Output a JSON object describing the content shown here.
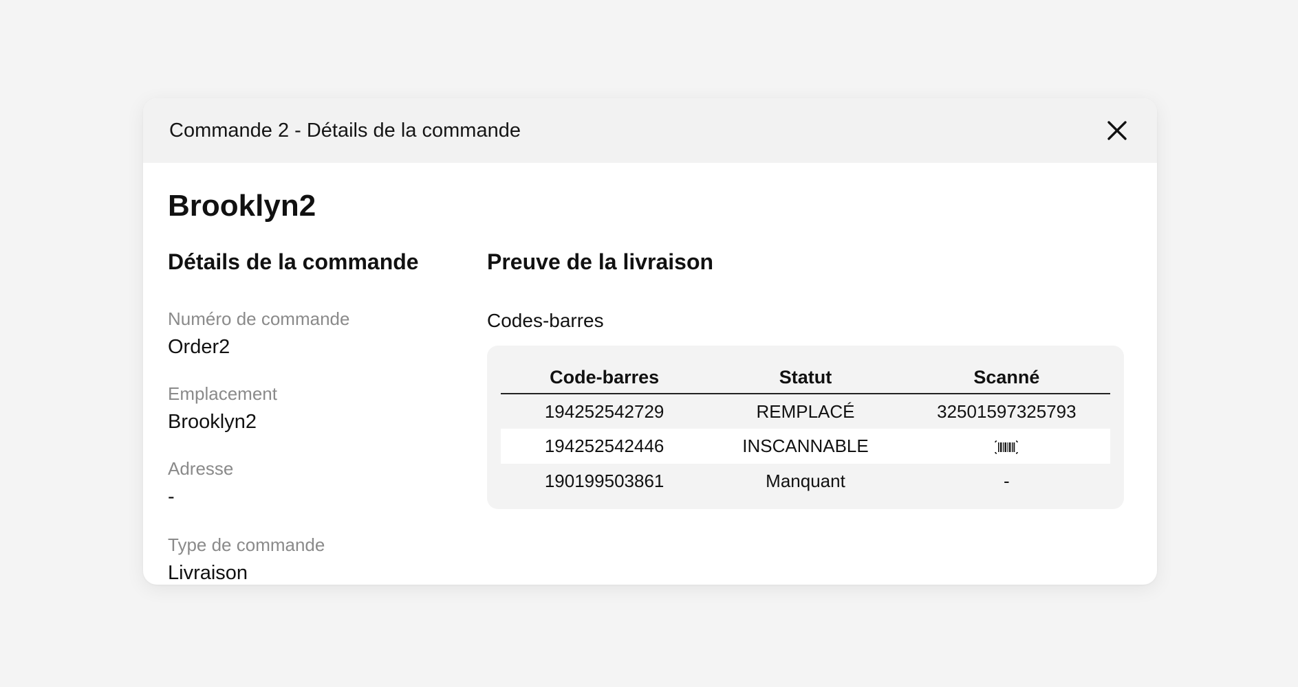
{
  "modal": {
    "title": "Commande 2 - Détails de la commande",
    "close_icon": "close-icon"
  },
  "location_name": "Brooklyn2",
  "order_details": {
    "heading": "Détails de la commande",
    "fields": [
      {
        "label": "Numéro de commande",
        "value": "Order2"
      },
      {
        "label": "Emplacement",
        "value": "Brooklyn2"
      },
      {
        "label": "Adresse",
        "value": "-"
      },
      {
        "label": "Type de commande",
        "value": "Livraison"
      }
    ]
  },
  "proof": {
    "heading": "Preuve de la livraison",
    "barcodes_label": "Codes-barres",
    "table": {
      "headers": [
        "Code-barres",
        "Statut",
        "Scanné"
      ],
      "rows": [
        {
          "barcode": "194252542729",
          "status": "REMPLACÉ",
          "scanned": "32501597325793"
        },
        {
          "barcode": "194252542446",
          "status": "INSCANNABLE",
          "scanned_icon": "barcode-icon"
        },
        {
          "barcode": "190199503861",
          "status": "Manquant",
          "scanned": "-"
        }
      ]
    }
  }
}
